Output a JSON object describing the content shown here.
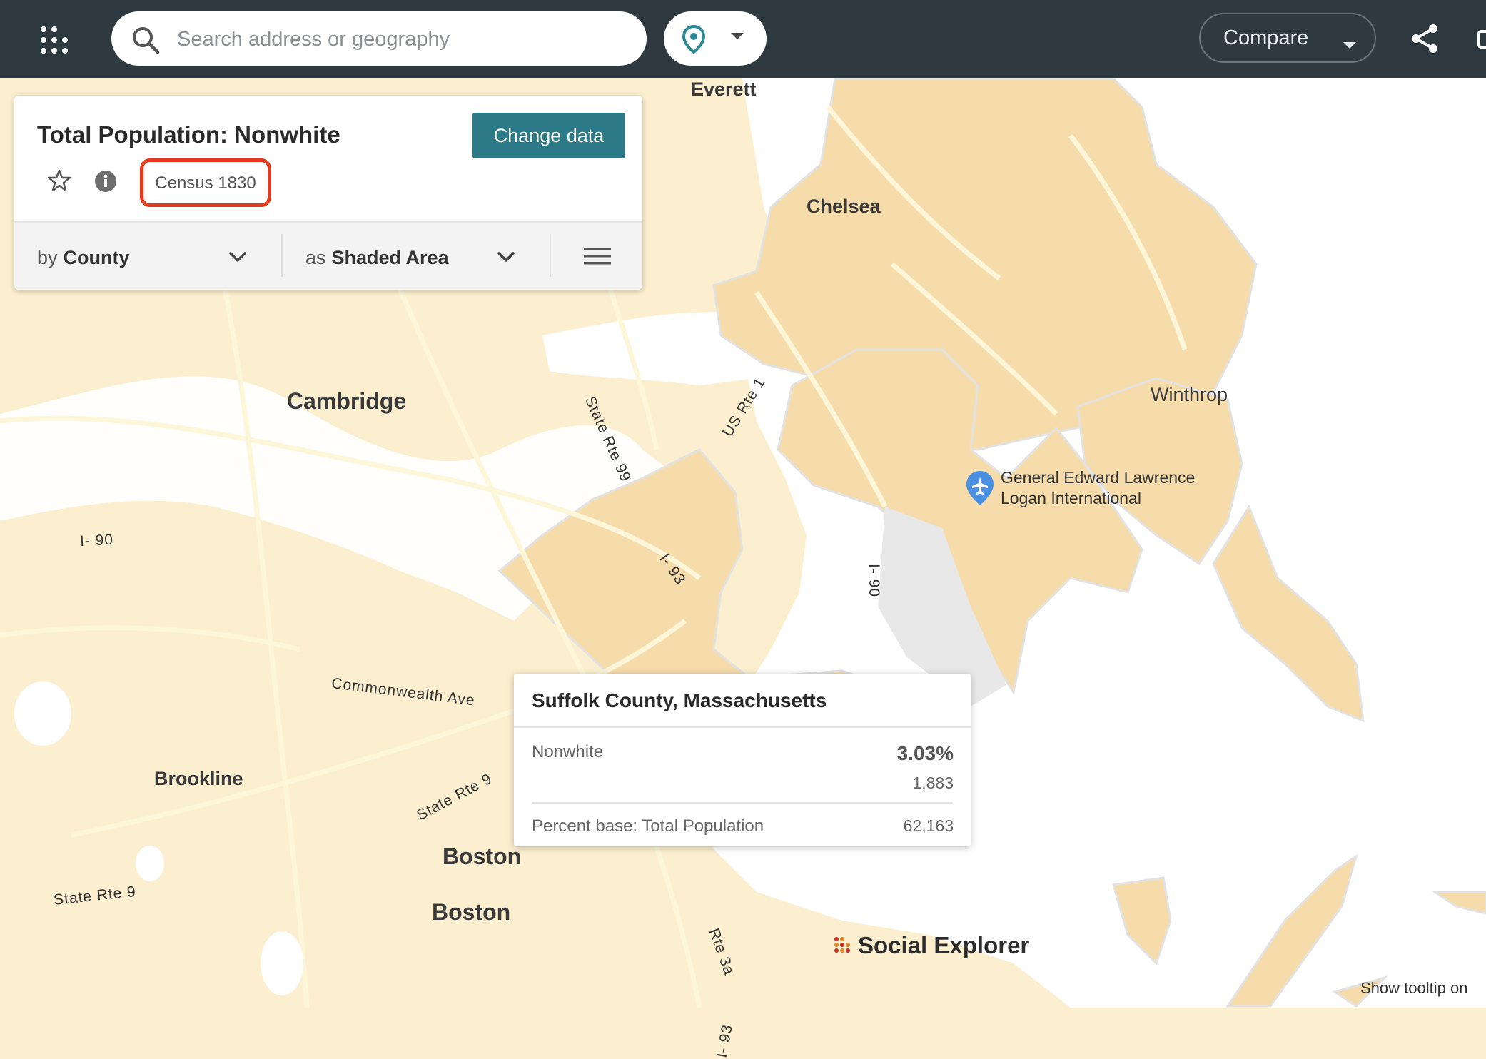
{
  "topbar": {
    "search_placeholder": "Search address or geography",
    "compare_label": "Compare"
  },
  "panel": {
    "title": "Total Population: Nonwhite",
    "change_button": "Change data",
    "survey": "Census 1830",
    "geo_prefix": "by",
    "geo_value": "County",
    "viz_prefix": "as",
    "viz_value": "Shaded Area"
  },
  "map": {
    "labels": {
      "everett": "Everett",
      "chelsea": "Chelsea",
      "cambridge": "Cambridge",
      "winthrop": "Winthrop",
      "airport_line1": "General Edward Lawrence",
      "airport_line2": "Logan International",
      "brookline": "Brookline",
      "boston1": "Boston",
      "boston2": "Boston",
      "i90_west": "I- 90",
      "i90_east": "I- 90",
      "i93_north": "I- 93",
      "i93_south": "I- 93",
      "us_rte1": "US Rte 1",
      "state_rte99": "State Rte 99",
      "commonwealth": "Commonwealth Ave",
      "state_rte9_a": "State Rte 9",
      "state_rte9_b": "State Rte 9",
      "rte3a": "Rte 3a"
    },
    "colors": {
      "land": "#fbefcf",
      "suffolk_fill": "#f6dcaa",
      "water": "#ffffff",
      "roads": "#fdf6d8"
    }
  },
  "tooltip": {
    "title": "Suffolk County, Massachusetts",
    "variable": "Nonwhite",
    "percent": "3.03%",
    "count": "1,883",
    "base_label": "Percent base: Total Population",
    "base_value": "62,163"
  },
  "footer": {
    "brand": "Social Explorer",
    "tooltip_toggle": "Show tooltip on"
  }
}
